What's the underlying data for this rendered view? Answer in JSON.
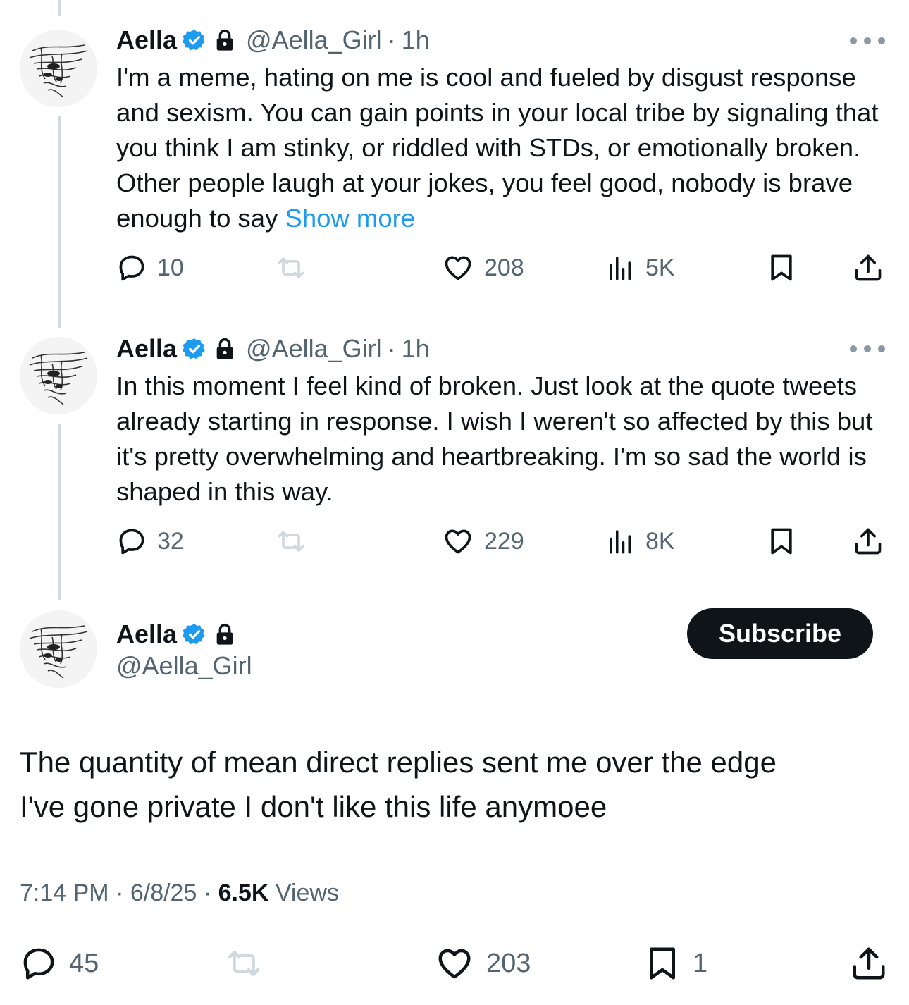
{
  "colors": {
    "accent": "#1d9bf0",
    "text": "#0f1419",
    "secondary": "#536471",
    "thread_line": "#cfd9de"
  },
  "tweets": [
    {
      "name": "Aella",
      "handle": "@Aella_Girl",
      "separator": "·",
      "time": "1h",
      "text": "I'm a meme, hating on me is cool and fueled by disgust response and sexism. You can gain points in your local tribe by signaling that you think I am stinky, or riddled with STDs, or emotionally broken. Other people laugh at your jokes, you feel good, nobody is brave enough to say",
      "show_more": "Show more",
      "replies": "10",
      "likes": "208",
      "views": "5K"
    },
    {
      "name": "Aella",
      "handle": "@Aella_Girl",
      "separator": "·",
      "time": "1h",
      "text": "In this moment I feel kind of broken. Just look at the quote tweets already starting in response. I wish I weren't so affected by this but it's pretty overwhelming and heartbreaking. I'm so sad the world is shaped in this way.",
      "replies": "32",
      "likes": "229",
      "views": "8K"
    }
  ],
  "main_tweet": {
    "name": "Aella",
    "handle": "@Aella_Girl",
    "subscribe_label": "Subscribe",
    "text_line1": "The quantity of mean direct replies sent me over the edge",
    "text_line2": "I've gone private I don't like this life anymoee",
    "time": "7:14 PM",
    "sep1": " · ",
    "date": "6/8/25",
    "sep2": " · ",
    "views_count": "6.5K",
    "views_label": " Views",
    "replies": "45",
    "likes": "203",
    "bookmarks": "1"
  }
}
